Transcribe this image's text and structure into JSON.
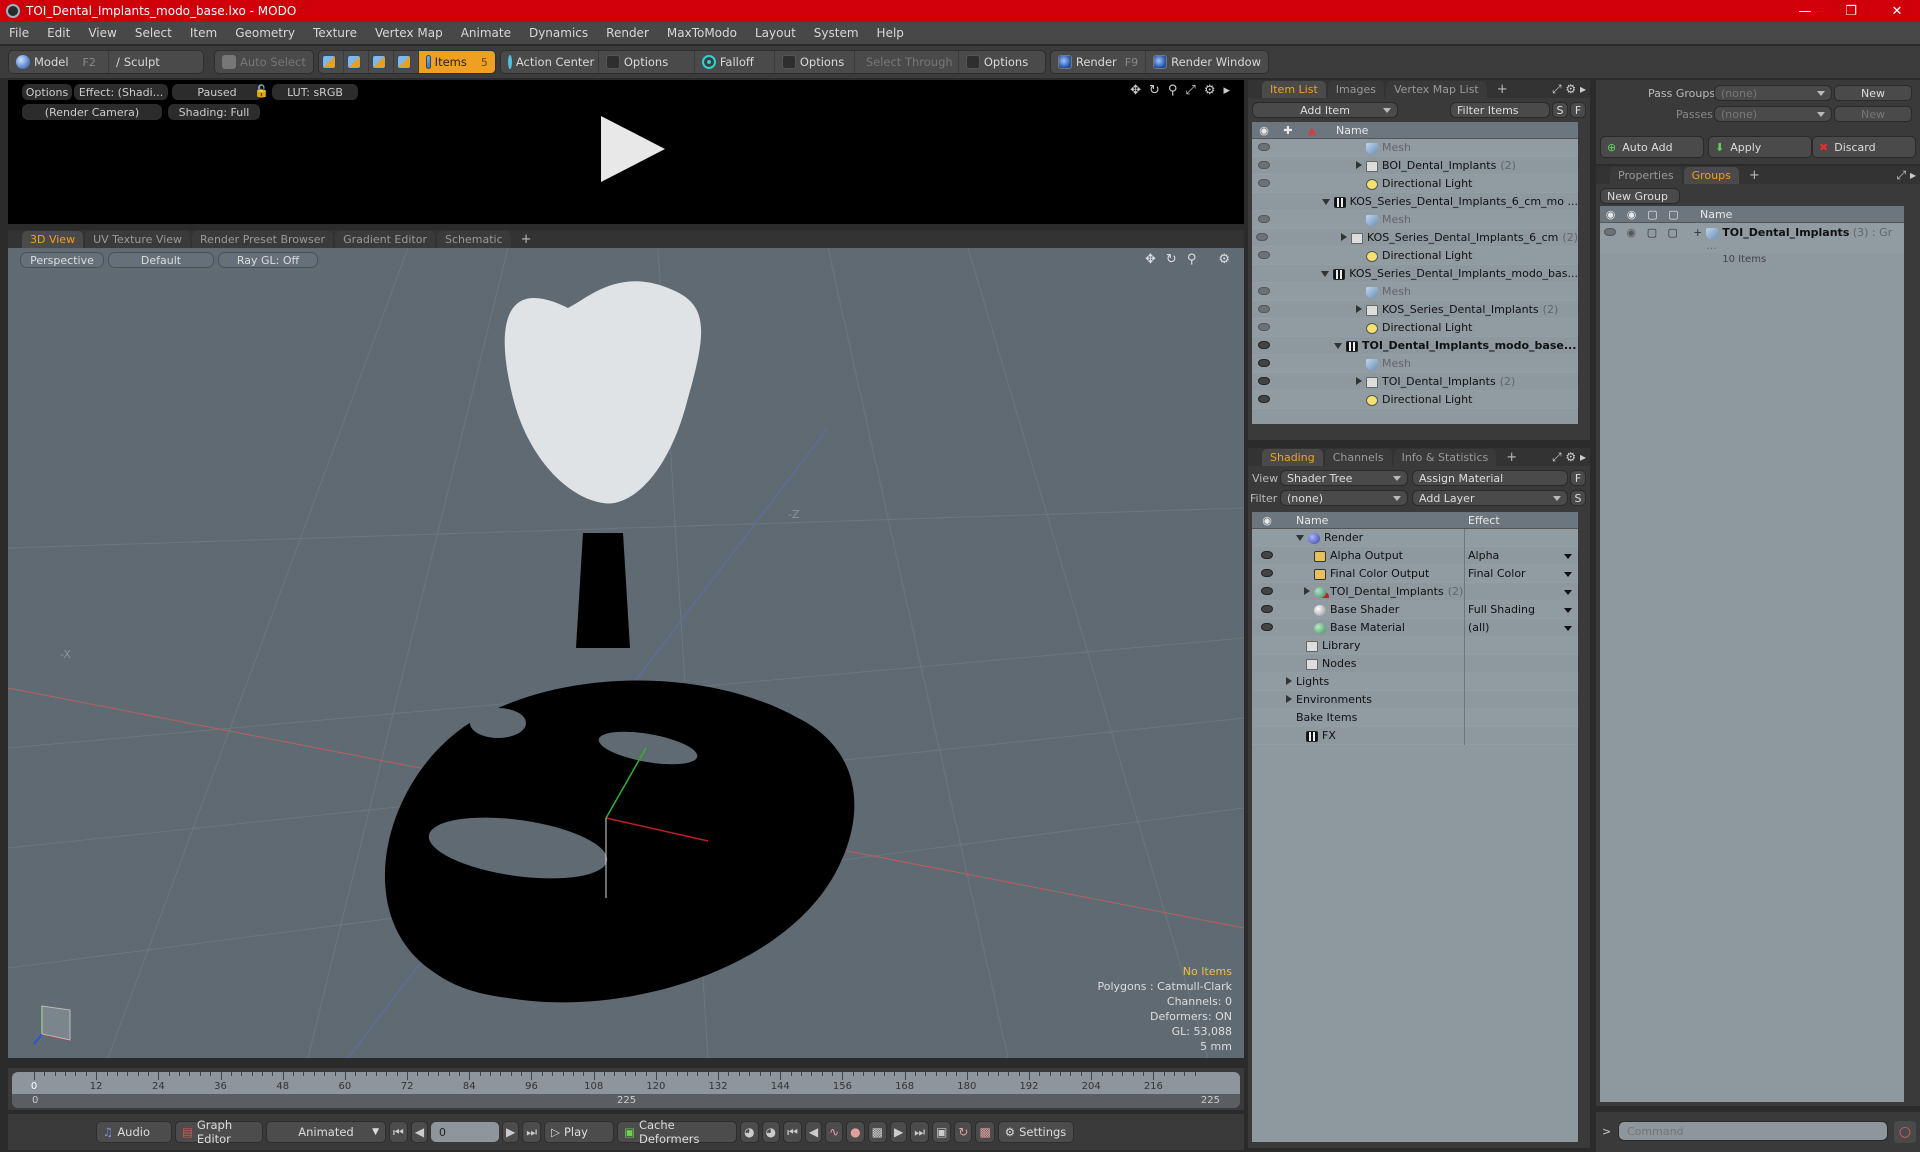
{
  "window": {
    "title": "TOI_Dental_Implants_modo_base.lxo - MODO",
    "controls": [
      "minimize-icon",
      "restore-icon",
      "close-icon"
    ]
  },
  "menu": [
    "File",
    "Edit",
    "View",
    "Select",
    "Item",
    "Geometry",
    "Texture",
    "Vertex Map",
    "Animate",
    "Dynamics",
    "Render",
    "MaxToModo",
    "Layout",
    "System",
    "Help"
  ],
  "toolbar": {
    "model": "Model",
    "model_key": "F2",
    "sculpt": "Sculpt",
    "auto_select": "Auto Select",
    "items": "Items",
    "items_key": "5",
    "action_center": "Action Center",
    "options1": "Options",
    "falloff": "Falloff",
    "options2": "Options",
    "select_through": "Select Through",
    "options3": "Options",
    "render": "Render",
    "render_key": "F9",
    "render_window": "Render Window"
  },
  "preview": {
    "options": "Options",
    "effect": "Effect: (Shadi...",
    "paused": "Paused",
    "lut": "LUT: sRGB",
    "camera": "(Render Camera)",
    "shading": "Shading: Full"
  },
  "viewport_tabs": [
    "3D View",
    "UV Texture View",
    "Render Preset Browser",
    "Gradient Editor",
    "Schematic",
    "+"
  ],
  "viewport": {
    "projection": "Perspective",
    "style": "Default",
    "raygl": "Ray GL: Off",
    "axis_label_negz": "-Z",
    "axis_label_x": "-X",
    "info": {
      "items": "No Items",
      "polygons": "Polygons : Catmull-Clark",
      "channels": "Channels: 0",
      "deformers": "Deformers: ON",
      "gl": "GL: 53,088",
      "unit": "5 mm"
    }
  },
  "timeline": {
    "ticks": [
      "0",
      "12",
      "24",
      "36",
      "48",
      "60",
      "72",
      "84",
      "96",
      "108",
      "120",
      "132",
      "144",
      "156",
      "168",
      "180",
      "192",
      "204",
      "216"
    ],
    "start": "0",
    "end": "225",
    "mid": "225",
    "current": "0"
  },
  "transport": {
    "audio": "Audio",
    "graph_editor": "Graph Editor",
    "animated": "Animated",
    "frame": "0",
    "play": "Play",
    "cache_deformers": "Cache Deformers",
    "settings": "Settings"
  },
  "item_list": {
    "tabs": [
      "Item List",
      "Images",
      "Vertex Map List",
      "+"
    ],
    "add_item": "Add Item",
    "filter": "Filter Items",
    "s": "S",
    "f": "F",
    "col_name": "Name",
    "rows": [
      {
        "label": "Mesh",
        "count": "",
        "type": "mesh",
        "indent": 2,
        "muted": true,
        "eye": "dim"
      },
      {
        "label": "BOI_Dental_Implants",
        "count": "(2)",
        "type": "folder",
        "indent": 2,
        "expander": "right",
        "eye": "dim"
      },
      {
        "label": "Directional Light",
        "count": "",
        "type": "light",
        "indent": 2,
        "eye": "dim"
      },
      {
        "label": "KOS_Series_Dental_Implants_6_cm_mo ...",
        "count": "",
        "type": "scene",
        "indent": 1,
        "expander": "down",
        "eye": "none"
      },
      {
        "label": "Mesh",
        "count": "",
        "type": "mesh",
        "indent": 2,
        "muted": true,
        "eye": "dim"
      },
      {
        "label": "KOS_Series_Dental_Implants_6_cm",
        "count": "(2)",
        "type": "folder",
        "indent": 2,
        "expander": "right",
        "eye": "dim"
      },
      {
        "label": "Directional Light",
        "count": "",
        "type": "light",
        "indent": 2,
        "eye": "dim"
      },
      {
        "label": "KOS_Series_Dental_Implants_modo_bas...",
        "count": "",
        "type": "scene",
        "indent": 1,
        "expander": "down",
        "eye": "none"
      },
      {
        "label": "Mesh",
        "count": "",
        "type": "mesh",
        "indent": 2,
        "muted": true,
        "eye": "dim"
      },
      {
        "label": "KOS_Series_Dental_Implants",
        "count": "(2)",
        "type": "folder",
        "indent": 2,
        "expander": "right",
        "eye": "dim"
      },
      {
        "label": "Directional Light",
        "count": "",
        "type": "light",
        "indent": 2,
        "eye": "dim"
      },
      {
        "label": "TOI_Dental_Implants_modo_base...",
        "count": "",
        "type": "scene",
        "indent": 1,
        "expander": "down",
        "bold": true,
        "eye": "on"
      },
      {
        "label": "Mesh",
        "count": "",
        "type": "mesh",
        "indent": 2,
        "muted": true,
        "eye": "on"
      },
      {
        "label": "TOI_Dental_Implants",
        "count": "(2)",
        "type": "folder",
        "indent": 2,
        "expander": "right",
        "eye": "on"
      },
      {
        "label": "Directional Light",
        "count": "",
        "type": "light",
        "indent": 2,
        "eye": "on"
      }
    ]
  },
  "shading": {
    "tabs": [
      "Shading",
      "Channels",
      "Info & Statistics",
      "+"
    ],
    "view_label": "View",
    "view_value": "Shader Tree",
    "assign_material": "Assign Material",
    "f": "F",
    "filter_label": "Filter",
    "filter_value": "(none)",
    "add_layer": "Add Layer",
    "s": "S",
    "col_name": "Name",
    "col_effect": "Effect",
    "rows": [
      {
        "label": "Render",
        "count": "",
        "effect": "",
        "type": "ball",
        "indent": 1,
        "expander": "down",
        "eye": false
      },
      {
        "label": "Alpha Output",
        "count": "",
        "effect": "Alpha",
        "type": "img",
        "indent": 2,
        "eye": true,
        "dd": true
      },
      {
        "label": "Final Color Output",
        "count": "",
        "effect": "Final Color",
        "type": "img",
        "indent": 2,
        "eye": true,
        "dd": true
      },
      {
        "label": "TOI_Dental_Implants",
        "count": "(2) ( ...",
        "effect": "",
        "type": "ballr",
        "indent": 2,
        "expander": "right",
        "eye": true,
        "dd": true
      },
      {
        "label": "Base Shader",
        "count": "",
        "effect": "Full Shading",
        "type": "ballw",
        "indent": 2,
        "eye": true,
        "dd": true
      },
      {
        "label": "Base Material",
        "count": "",
        "effect": "(all)",
        "type": "ballg",
        "indent": 2,
        "eye": true,
        "dd": true
      },
      {
        "label": "Library",
        "count": "",
        "effect": "",
        "type": "folder",
        "indent": 1,
        "eye": false
      },
      {
        "label": "Nodes",
        "count": "",
        "effect": "",
        "type": "folder",
        "indent": 1,
        "eye": false
      },
      {
        "label": "Lights",
        "count": "",
        "effect": "",
        "type": "none",
        "indent": 0,
        "expander": "right",
        "eye": false
      },
      {
        "label": "Environments",
        "count": "",
        "effect": "",
        "type": "none",
        "indent": 0,
        "expander": "right",
        "eye": false
      },
      {
        "label": "Bake Items",
        "count": "",
        "effect": "",
        "type": "none",
        "indent": 0,
        "eye": false
      },
      {
        "label": "FX",
        "count": "",
        "effect": "",
        "type": "scene",
        "indent": 1,
        "eye": false
      }
    ]
  },
  "passes": {
    "pass_groups_label": "Pass Groups",
    "pass_groups_value": "(none)",
    "new1": "New",
    "passes_label": "Passes",
    "passes_value": "(none)",
    "new2": "New",
    "auto_add": "Auto Add",
    "apply": "Apply",
    "discard": "Discard"
  },
  "groups": {
    "tabs": [
      "Properties",
      "Groups",
      "+"
    ],
    "new_group": "New Group",
    "col_name": "Name",
    "rows": [
      {
        "label": "TOI_Dental_Implants",
        "count": "(3)",
        "suffix": ": Gr ...",
        "sub": "10 Items"
      }
    ]
  },
  "command": {
    "placeholder": "Command",
    "prompt": ">"
  }
}
